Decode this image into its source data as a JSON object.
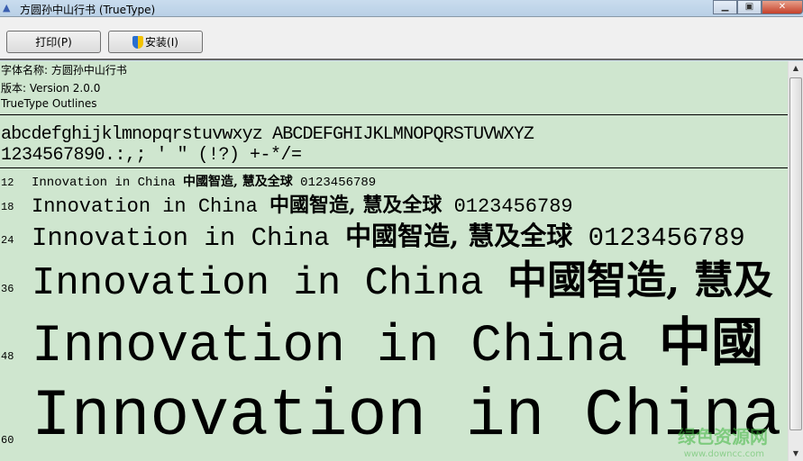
{
  "window": {
    "title": "方圆孙中山行书 (TrueType)"
  },
  "toolbar": {
    "print_label": "打印(P)",
    "install_label": "安装(I)"
  },
  "info": {
    "font_name": "字体名称: 方圆孙中山行书",
    "version": "版本: Version 2.0.0",
    "type": "TrueType Outlines"
  },
  "charset": {
    "line1": "abcdefghijklmnopqrstuvwxyz ABCDEFGHIJKLMNOPQRSTUVWXYZ",
    "line2": "1234567890.:,; ' \" (!?) +-*/="
  },
  "samples": [
    {
      "size": "12",
      "latin": "Innovation in China ",
      "cjk": "中國智造, 慧及全球",
      "digits": " 0123456789"
    },
    {
      "size": "18",
      "latin": "Innovation in China ",
      "cjk": "中國智造, 慧及全球",
      "digits": " 0123456789"
    },
    {
      "size": "24",
      "latin": "Innovation in China ",
      "cjk": "中國智造, 慧及全球",
      "digits": " 0123456789"
    },
    {
      "size": "36",
      "latin": "Innovation in China ",
      "cjk": "中國智造, 慧及",
      "digits": ""
    },
    {
      "size": "48",
      "latin": "Innovation in China ",
      "cjk": "中國",
      "digits": ""
    },
    {
      "size": "60",
      "latin": "Innovation in China",
      "cjk": "",
      "digits": ""
    }
  ],
  "watermark": {
    "text": "绿色资源网",
    "url": "www.downcc.com"
  }
}
